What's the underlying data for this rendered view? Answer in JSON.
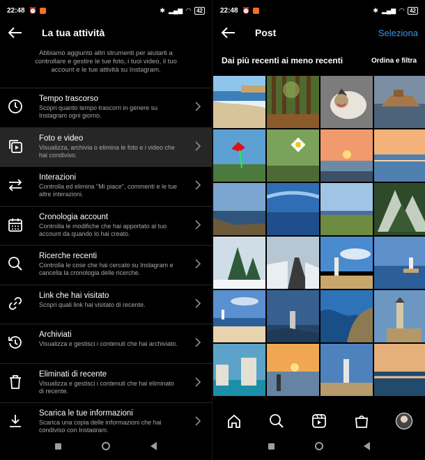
{
  "left": {
    "status": {
      "time": "22:48",
      "battery": "42"
    },
    "title": "La tua attività",
    "intro": "Abbiamo aggiunto altri strumenti per aiutarti a controllare e gestire le tue foto, i tuoi video, il tuo account e le tue attività su Instagram.",
    "items": [
      {
        "icon": "clock-icon",
        "label": "Tempo trascorso",
        "desc": "Scopri quanto tempo trascorri in genere su Instagram ogni giorno."
      },
      {
        "icon": "media-icon",
        "label": "Foto e video",
        "desc": "Visualizza, archivia o elimina le foto e i video che hai condiviso."
      },
      {
        "icon": "arrows-icon",
        "label": "Interazioni",
        "desc": "Controlla ed elimina \"Mi piace\", commenti e le tue altre interazioni."
      },
      {
        "icon": "calendar-icon",
        "label": "Cronologia account",
        "desc": "Controlla le modifiche che hai apportato al tuo account da quando lo hai creato."
      },
      {
        "icon": "search-icon",
        "label": "Ricerche recenti",
        "desc": "Controlla le cose che hai cercato su Instagram e cancella la cronologia delle ricerche."
      },
      {
        "icon": "link-icon",
        "label": "Link che hai visitato",
        "desc": "Scopri quali link hai visitato di recente."
      },
      {
        "icon": "archive-icon",
        "label": "Archiviati",
        "desc": "Visualizza e gestisci i contenuti che hai archiviato."
      },
      {
        "icon": "trash-icon",
        "label": "Eliminati di recente",
        "desc": "Visualizza e gestisci i contenuti che hai eliminato di recente."
      },
      {
        "icon": "download-icon",
        "label": "Scarica le tue informazioni",
        "desc": "Scarica una copia delle informazioni che hai condiviso con Instagram."
      }
    ]
  },
  "right": {
    "status": {
      "time": "22:48",
      "battery": "42"
    },
    "title": "Post",
    "select_label": "Seleziona",
    "sort_label": "Dai più recenti ai meno recenti",
    "filter_label": "Ordina e filtra",
    "tabs": [
      "home-icon",
      "search-icon",
      "reels-icon",
      "shop-icon",
      "profile-avatar"
    ]
  },
  "colors": {
    "accent": "#3797f0",
    "background": "#000000",
    "active_row": "#262626",
    "secondary_text": "#a8a8a8"
  }
}
